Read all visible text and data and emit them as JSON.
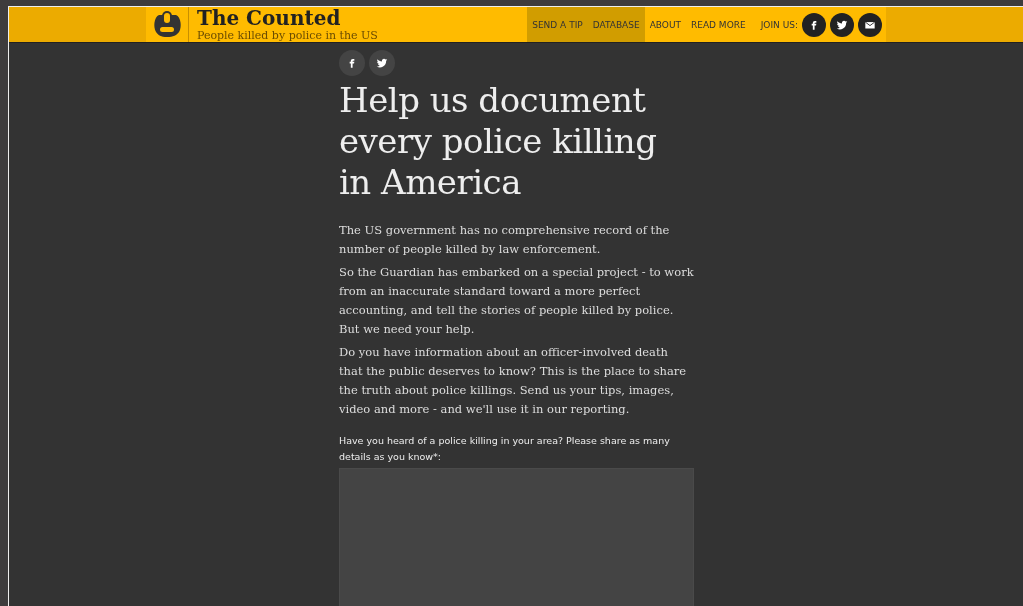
{
  "header": {
    "title": "The Counted",
    "subtitle": "People killed by police in the US",
    "nav": [
      {
        "label": "SEND A TIP",
        "selected": true
      },
      {
        "label": "DATABASE",
        "selected": true
      },
      {
        "label": "ABOUT",
        "selected": false
      },
      {
        "label": "READ MORE",
        "selected": false
      }
    ],
    "join_label": "JOIN US:",
    "social": [
      {
        "kind": "facebook"
      },
      {
        "kind": "twitter"
      },
      {
        "kind": "email"
      }
    ]
  },
  "share": [
    {
      "kind": "facebook"
    },
    {
      "kind": "twitter"
    }
  ],
  "headline": "Help us document every police killing in America",
  "paragraphs": [
    "The US government has no comprehensive record of the number of people killed by law enforcement.",
    "So the Guardian has embarked on a special project - to work from an inaccurate standard toward a more perfect accounting, and tell the stories of people killed by police. But we need your help.",
    "Do you have information about an officer-involved death that the public deserves to know? This is the place to share the truth about police killings. Send us your tips, images, video and more - and we'll use it in our reporting."
  ],
  "form": {
    "question": "Have you heard of a police killing in your area? Please share as many details as you know*:"
  }
}
